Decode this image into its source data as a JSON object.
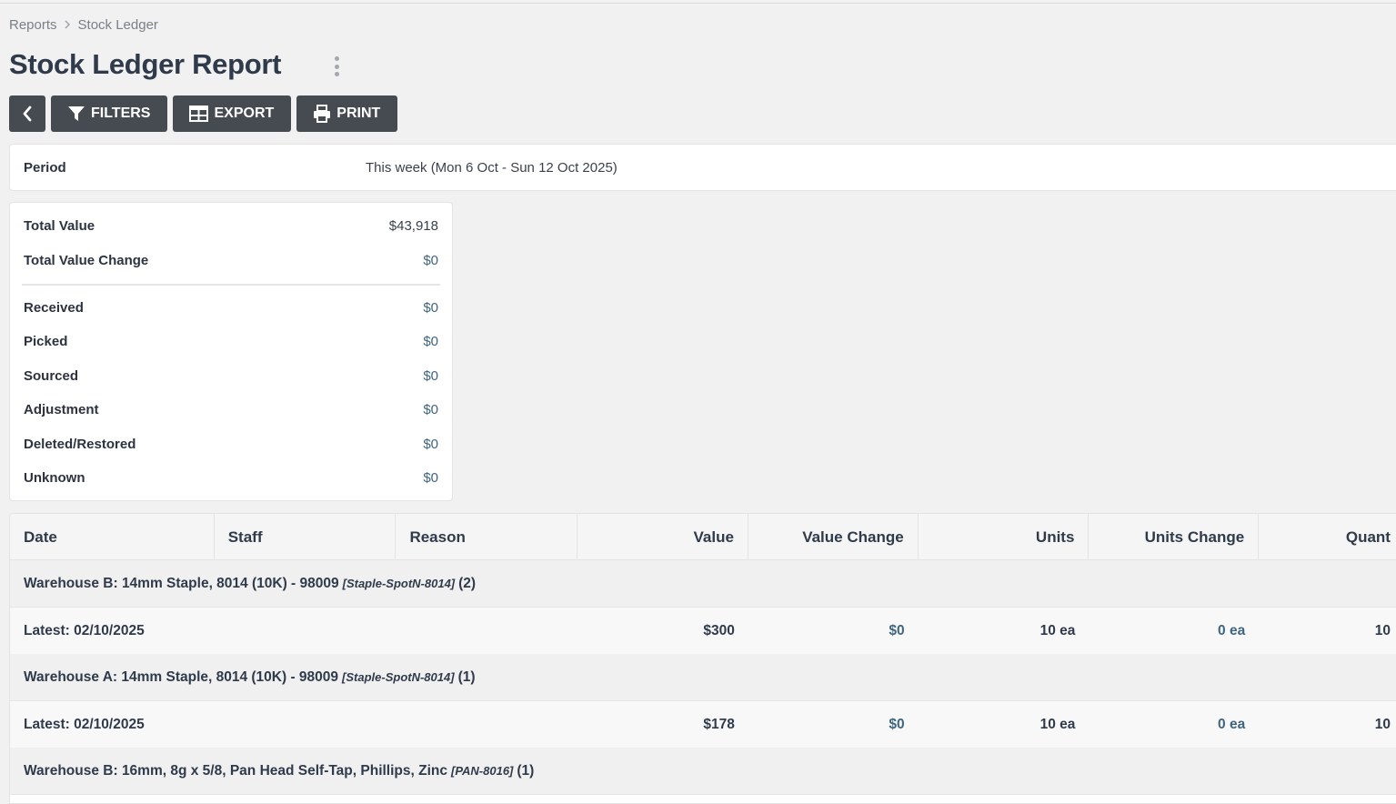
{
  "breadcrumb": {
    "items": [
      "Reports",
      "Stock Ledger"
    ]
  },
  "page_title": "Stock Ledger Report",
  "toolbar": {
    "filters_label": "FILTERS",
    "export_label": "EXPORT",
    "print_label": "PRINT"
  },
  "icons": {
    "back": "chevron-left-icon",
    "filters": "funnel-icon",
    "export": "table-grid-icon",
    "print": "printer-icon",
    "more": "kebab-icon"
  },
  "colors": {
    "button_bg": "#464b52",
    "link_value": "#3f6580"
  },
  "period": {
    "label": "Period",
    "value": "This week (Mon 6 Oct - Sun 12 Oct 2025)"
  },
  "summary": {
    "total_value": {
      "label": "Total Value",
      "value": "$43,918"
    },
    "total_value_change": {
      "label": "Total Value Change",
      "value": "$0"
    },
    "rows": [
      {
        "label": "Received",
        "value": "$0"
      },
      {
        "label": "Picked",
        "value": "$0"
      },
      {
        "label": "Sourced",
        "value": "$0"
      },
      {
        "label": "Adjustment",
        "value": "$0"
      },
      {
        "label": "Deleted/Restored",
        "value": "$0"
      },
      {
        "label": "Unknown",
        "value": "$0"
      }
    ]
  },
  "table": {
    "columns": [
      "Date",
      "Staff",
      "Reason",
      "Value",
      "Value Change",
      "Units",
      "Units Change",
      "Quant"
    ],
    "groups": [
      {
        "title": "Warehouse B: 14mm Staple, 8014 (10K) - 98009",
        "sku": "[Staple-SpotN-8014]",
        "count": "(2)",
        "latest": {
          "label": "Latest: 02/10/2025",
          "value": "$300",
          "value_change": "$0",
          "units": "10 ea",
          "units_change": "0 ea",
          "quantity": "10"
        }
      },
      {
        "title": "Warehouse A: 14mm Staple, 8014 (10K) - 98009",
        "sku": "[Staple-SpotN-8014]",
        "count": "(1)",
        "latest": {
          "label": "Latest: 02/10/2025",
          "value": "$178",
          "value_change": "$0",
          "units": "10 ea",
          "units_change": "0 ea",
          "quantity": "10"
        }
      },
      {
        "title": "Warehouse B: 16mm, 8g x 5/8, Pan Head Self-Tap, Phillips, Zinc",
        "sku": "[PAN-8016]",
        "count": "(1)"
      }
    ]
  }
}
